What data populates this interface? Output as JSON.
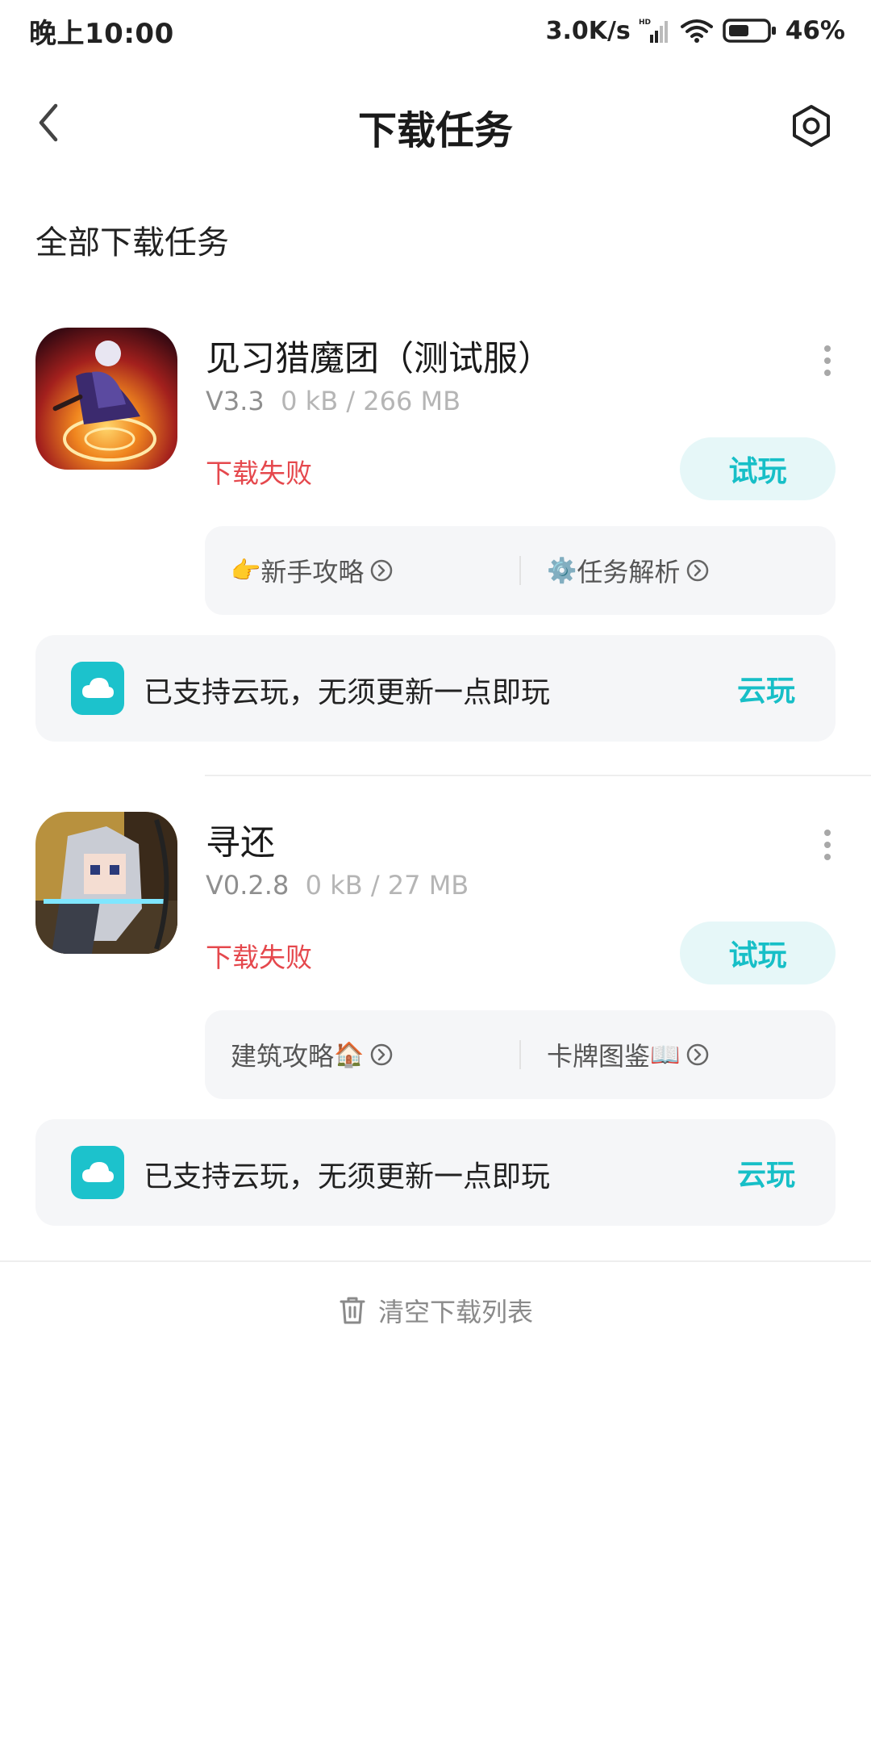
{
  "status_bar": {
    "time": "晚上10:00",
    "net_speed": "3.0K/s",
    "battery": "46%"
  },
  "header": {
    "title": "下载任务",
    "back_icon": "chevron-left-icon",
    "settings_icon": "hexagon-gear-icon"
  },
  "section_title": "全部下载任务",
  "tasks": [
    {
      "name": "见习猎魔团（测试服）",
      "version": "V3.3",
      "size": "0 kB / 266 MB",
      "status": "下载失败",
      "try_label": "试玩",
      "guides": [
        {
          "prefix_emoji": "👉",
          "label": "新手攻略",
          "suffix_emoji": ""
        },
        {
          "prefix_emoji": "⚙️",
          "label": "任务解析",
          "suffix_emoji": ""
        }
      ],
      "cloud_text": "已支持云玩，无须更新一点即玩",
      "cloud_action": "云玩"
    },
    {
      "name": "寻还",
      "version": "V0.2.8",
      "size": "0 kB / 27 MB",
      "status": "下载失败",
      "try_label": "试玩",
      "guides": [
        {
          "prefix_emoji": "",
          "label": "建筑攻略",
          "suffix_emoji": "🏠"
        },
        {
          "prefix_emoji": "",
          "label": "卡牌图鉴",
          "suffix_emoji": "📖"
        }
      ],
      "cloud_text": "已支持云玩，无须更新一点即玩",
      "cloud_action": "云玩"
    }
  ],
  "clear_label": "清空下载列表",
  "colors": {
    "accent": "#17bfc7",
    "error": "#e5484d",
    "card_bg": "#f5f6f8"
  }
}
